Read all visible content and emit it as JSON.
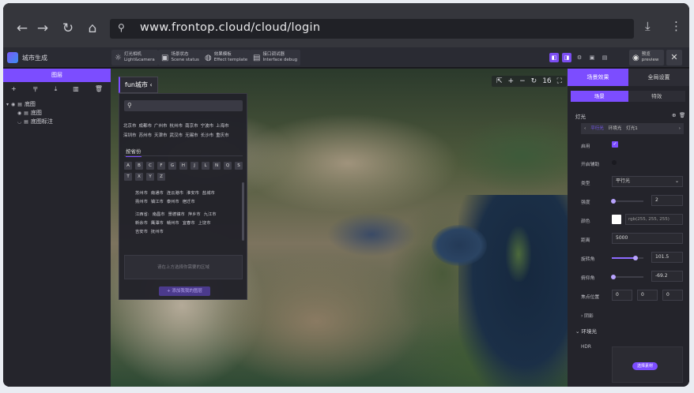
{
  "browser": {
    "url": "www.frontop.cloud/cloud/login",
    "back": "←",
    "forward": "→",
    "reload": "↻",
    "home": "⌂",
    "download": "⤓",
    "menu": "⋮"
  },
  "app": {
    "name": "城市生成",
    "toolbar": [
      {
        "icon": "☼",
        "cn": "灯光相机",
        "en": "Light&camera"
      },
      {
        "icon": "▣",
        "cn": "场景状态",
        "en": "Scene status"
      },
      {
        "icon": "◍",
        "cn": "效果模板",
        "en": "Effect template"
      },
      {
        "icon": "▤",
        "cn": "接口调试器",
        "en": "Interface debug"
      }
    ],
    "preview_cn": "预览",
    "preview_en": "preview",
    "close": "✕"
  },
  "left": {
    "tab": "图层",
    "tools": [
      "+",
      "〒",
      "⤓",
      "▥",
      "🗑"
    ],
    "tree": [
      {
        "label": "底图",
        "level": 0
      },
      {
        "label": "底图",
        "level": 1
      },
      {
        "label": "底图标注",
        "level": 1
      }
    ]
  },
  "map": {
    "controls": [
      "⇱",
      "+",
      "−",
      "↻",
      "16",
      "⛶"
    ]
  },
  "city": {
    "button": "fun城市 ‹",
    "hot_row1": [
      "北京市",
      "成都市",
      "广州市",
      "杭州市",
      "南京市",
      "宁波市",
      "上海市"
    ],
    "hot_row2": [
      "深圳市",
      "苏州市",
      "天津市",
      "武汉市",
      "无锡市",
      "长沙市",
      "重庆市"
    ],
    "province_tab": "按省份",
    "letters": [
      "A",
      "B",
      "C",
      "F",
      "G",
      "H",
      "J",
      "L",
      "N",
      "Q",
      "S",
      "T",
      "X",
      "Y",
      "Z"
    ],
    "list1": [
      "苏州市",
      "南通市",
      "连云港市",
      "淮安市",
      "盐城市"
    ],
    "list2": [
      "扬州市",
      "镇江市",
      "泰州市",
      "宿迁市"
    ],
    "list3": [
      "江西省:",
      "南昌市",
      "景德镇市",
      "萍乡市",
      "九江市"
    ],
    "list4": [
      "新余市",
      "鹰潭市",
      "赣州市",
      "宜春市",
      "上饶市"
    ],
    "list5": [
      "吉安市",
      "抚州市"
    ],
    "empty": "请在上方选择你需要的区域",
    "add": "+ 添加我我的图层"
  },
  "right": {
    "tabs": [
      "场景效果",
      "全局设置"
    ],
    "subtabs": [
      "场景",
      "特效"
    ],
    "light_section": "灯光",
    "light_options": [
      "‹",
      "平行光",
      "环境光",
      "灯光1",
      "›"
    ],
    "labels": {
      "enable": "启用",
      "helper": "开启辅助",
      "type": "类型",
      "intensity": "强度",
      "color": "颜色",
      "distance": "距离",
      "rotation": "旋转角",
      "pitch": "俯仰角",
      "focus": "焦点位置",
      "shadow": "阴影",
      "env": "环境光",
      "hdr": "HDR"
    },
    "type_value": "平行光",
    "intensity": "2",
    "intensity_fraction": 0.05,
    "color_text": "rgb(255, 255, 255)",
    "distance": "5000",
    "rotation": "101.5",
    "rotation_fraction": 0.75,
    "pitch": "-69.2",
    "pitch_fraction": 0.04,
    "focus": [
      "0",
      "0",
      "0"
    ],
    "hdr_button": "选择素材",
    "accent": "#7c4dff"
  }
}
